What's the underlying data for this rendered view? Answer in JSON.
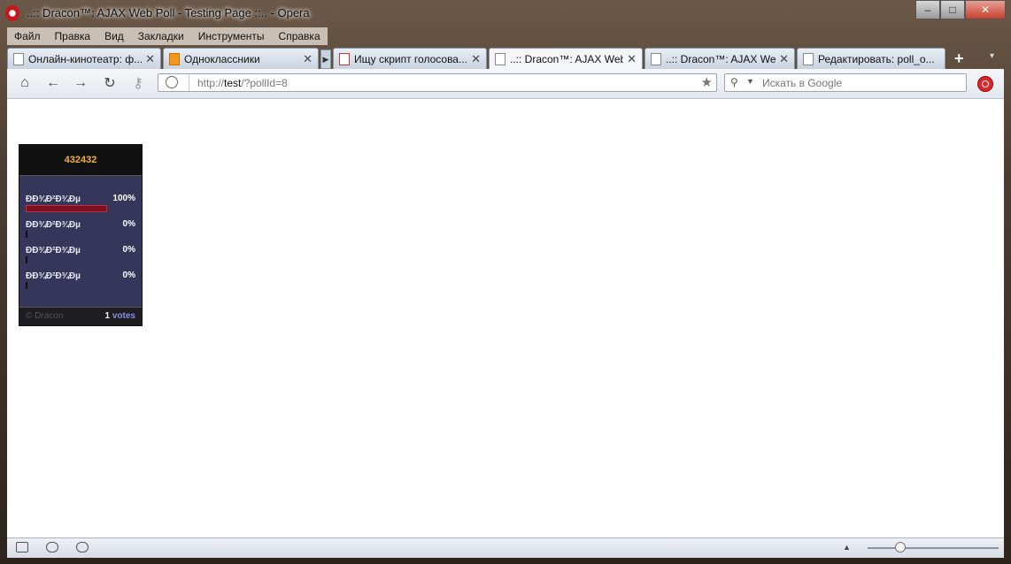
{
  "window": {
    "title": "..:: Dracon™: AJAX Web Poll - Testing Page ::.. - Opera",
    "minimize": "–",
    "maximize": "□",
    "close": "✕"
  },
  "menu": [
    "Файл",
    "Правка",
    "Вид",
    "Закладки",
    "Инструменты",
    "Справка"
  ],
  "tabs": [
    {
      "label": "Онлайн-кинотеатр: ф...",
      "icon": "page-icon"
    },
    {
      "label": "Одноклассники",
      "icon": "odnoklassniki-icon"
    },
    {
      "label": "Ищу скрипт голосова...",
      "icon": "cms-icon"
    },
    {
      "label": "..:: Dracon™: AJAX Web...",
      "icon": "page-icon",
      "active": true
    },
    {
      "label": "..:: Dracon™: AJAX Web...",
      "icon": "page-icon"
    },
    {
      "label": "Редактировать: poll_o...",
      "icon": "edit-icon"
    }
  ],
  "address": {
    "prefix": "http://",
    "host": "test",
    "path": "/?pollId=8"
  },
  "search": {
    "placeholder": "Искать в Google"
  },
  "poll": {
    "title": "432432",
    "options": [
      {
        "label": "ÐÐ¾Ð²Ð¾Ðµ",
        "percent": "100%",
        "fraction": 1.0
      },
      {
        "label": "ÐÐ¾Ð²Ð¾Ðµ",
        "percent": "0%",
        "fraction": 0.0
      },
      {
        "label": "ÐÐ¾Ð²Ð¾Ðµ",
        "percent": "0%",
        "fraction": 0.0
      },
      {
        "label": "ÐÐ¾Ð²Ð¾Ðµ",
        "percent": "0%",
        "fraction": 0.0
      }
    ],
    "copyright": "© Dracon",
    "votes_count": "1",
    "votes_label": "votes"
  },
  "statusbar": {
    "zoom_fraction": 0.25
  }
}
